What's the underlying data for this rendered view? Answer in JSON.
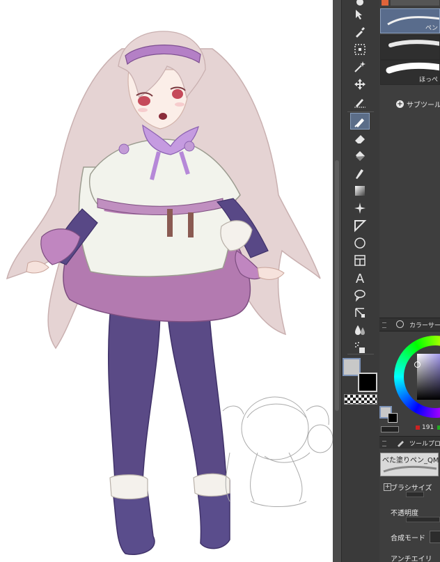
{
  "brushes": [
    {
      "label": "ペン"
    },
    {
      "label": ""
    },
    {
      "label": "ほっぺ"
    }
  ],
  "subtool": {
    "add_label": "サブツール"
  },
  "color_panel": {
    "title": "カラーサークル",
    "r_value": "191"
  },
  "tool_property": {
    "title": "ツールプロパティ",
    "tool_name": "べた塗りペン_QM",
    "brush_size_label": "ブラシサイズ",
    "opacity_label": "不透明度",
    "blend_mode_label": "合成モード",
    "antialias_label": "アンチエイリ"
  },
  "colors": {
    "main_color": "#c8c8c8",
    "sub_color": "#000000",
    "selected_accent": "#5b6d88"
  },
  "toolbar": {
    "tools": [
      "object-selection-icon",
      "eyedropper-icon",
      "vector-select-icon",
      "magic-wand-icon",
      "move-icon",
      "pen-settings-icon",
      "pen-icon",
      "eraser-icon",
      "fill-bucket-icon",
      "airbrush-icon",
      "gradient-icon",
      "sparkle-decoration-icon",
      "figure-triangle-icon",
      "ellipse-icon",
      "frame-border-icon",
      "text-icon",
      "balloon-icon",
      "ruler-link-icon",
      "blend-drops-icon",
      "pattern-spray-icon"
    ]
  }
}
